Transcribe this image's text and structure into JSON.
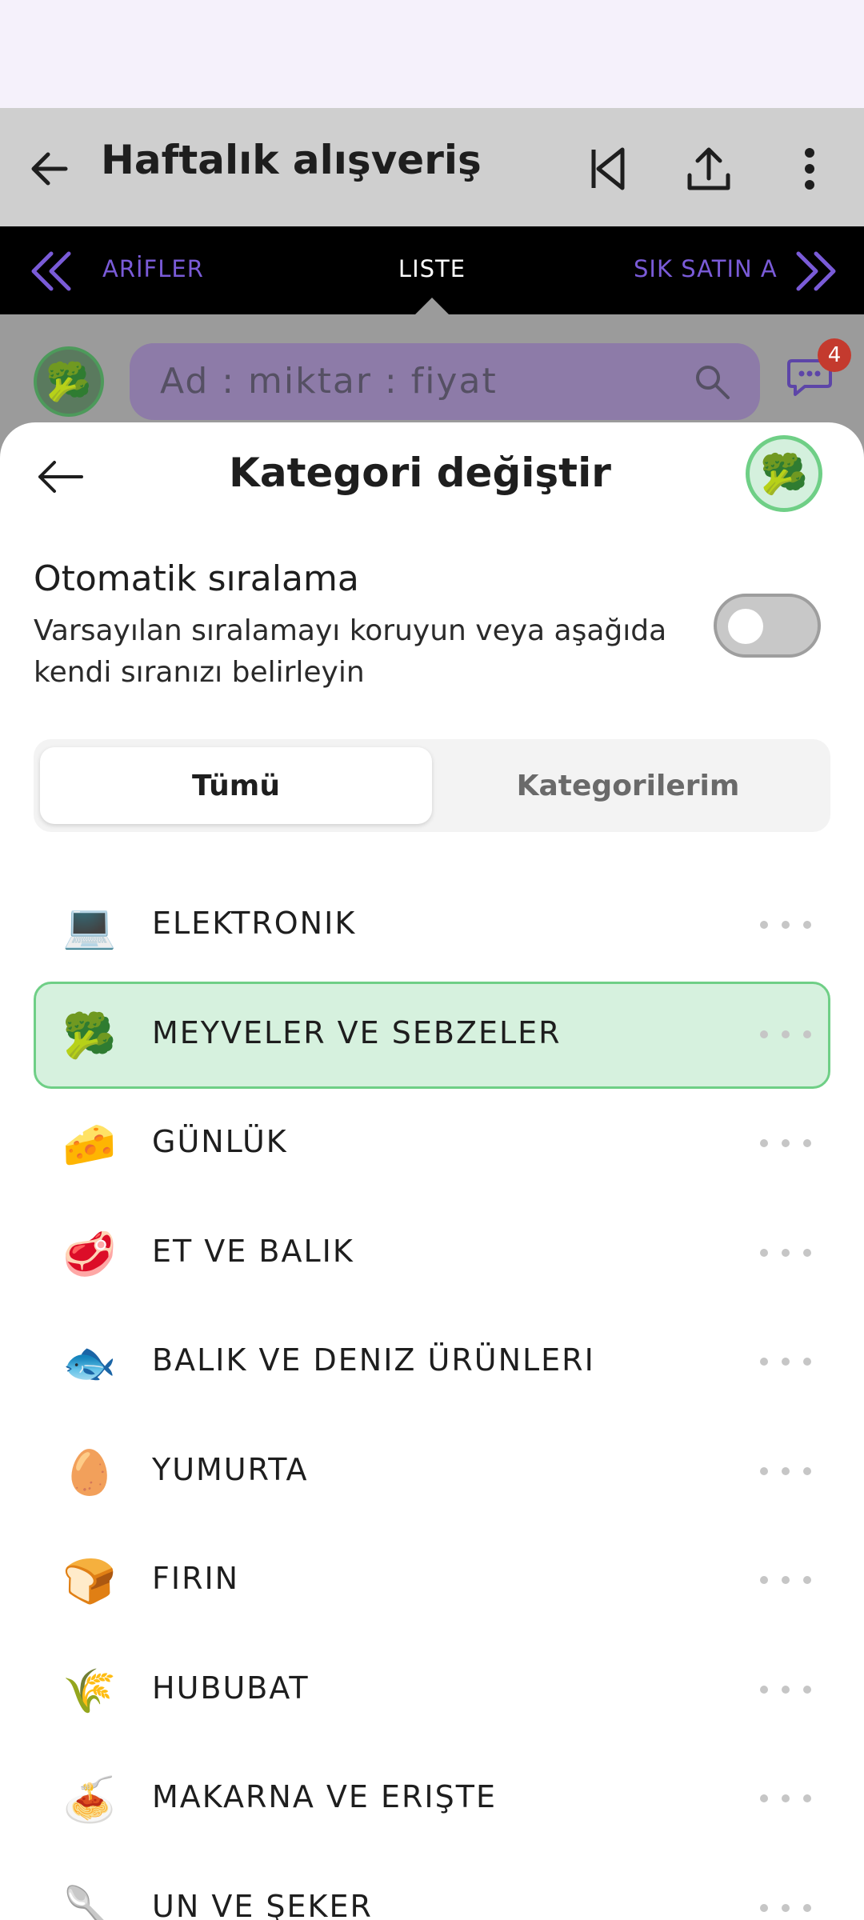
{
  "app_bar": {
    "title": "Haftalık alışveriş"
  },
  "tabs": {
    "left": "ARİFLER",
    "center": "LISTE",
    "right": "SIK SATIN A"
  },
  "quick_add": {
    "placeholder": "Ad : miktar : fiyat",
    "badge_count": "4"
  },
  "sheet": {
    "title": "Kategori değiştir",
    "auto_sort": {
      "heading": "Otomatik sıralama",
      "description": "Varsayılan sıralamayı koruyun veya aşağıda kendi sıranızı belirleyin",
      "enabled": false
    },
    "segments": {
      "all": "Tümü",
      "mine": "Kategorilerim",
      "selected": "all"
    },
    "categories": [
      {
        "label": "ELEKTRONIK",
        "icon": "laptop-icon",
        "emoji": "💻",
        "selected": false
      },
      {
        "label": "MEYVELER VE SEBZELER",
        "icon": "broccoli-icon",
        "emoji": "🥦",
        "selected": true
      },
      {
        "label": "GÜNLÜK",
        "icon": "cheese-icon",
        "emoji": "🧀",
        "selected": false
      },
      {
        "label": "ET VE BALIK",
        "icon": "meat-icon",
        "emoji": "🥩",
        "selected": false
      },
      {
        "label": "BALIK VE DENIZ ÜRÜNLERI",
        "icon": "fish-icon",
        "emoji": "🐟",
        "selected": false
      },
      {
        "label": "YUMURTA",
        "icon": "egg-icon",
        "emoji": "🥚",
        "selected": false
      },
      {
        "label": "FIRIN",
        "icon": "bread-icon",
        "emoji": "🍞",
        "selected": false
      },
      {
        "label": "HUBUBAT",
        "icon": "grain-icon",
        "emoji": "🌾",
        "selected": false
      },
      {
        "label": "MAKARNA VE ERIŞTE",
        "icon": "pasta-icon",
        "emoji": "🍝",
        "selected": false
      },
      {
        "label": "UN VE ŞEKER",
        "icon": "spoon-icon",
        "emoji": "🥄",
        "selected": false
      }
    ]
  },
  "colors": {
    "accent_green": "#6fcf86",
    "selected_bg": "#d6f1de",
    "tab_accent": "#7a5bd8"
  }
}
